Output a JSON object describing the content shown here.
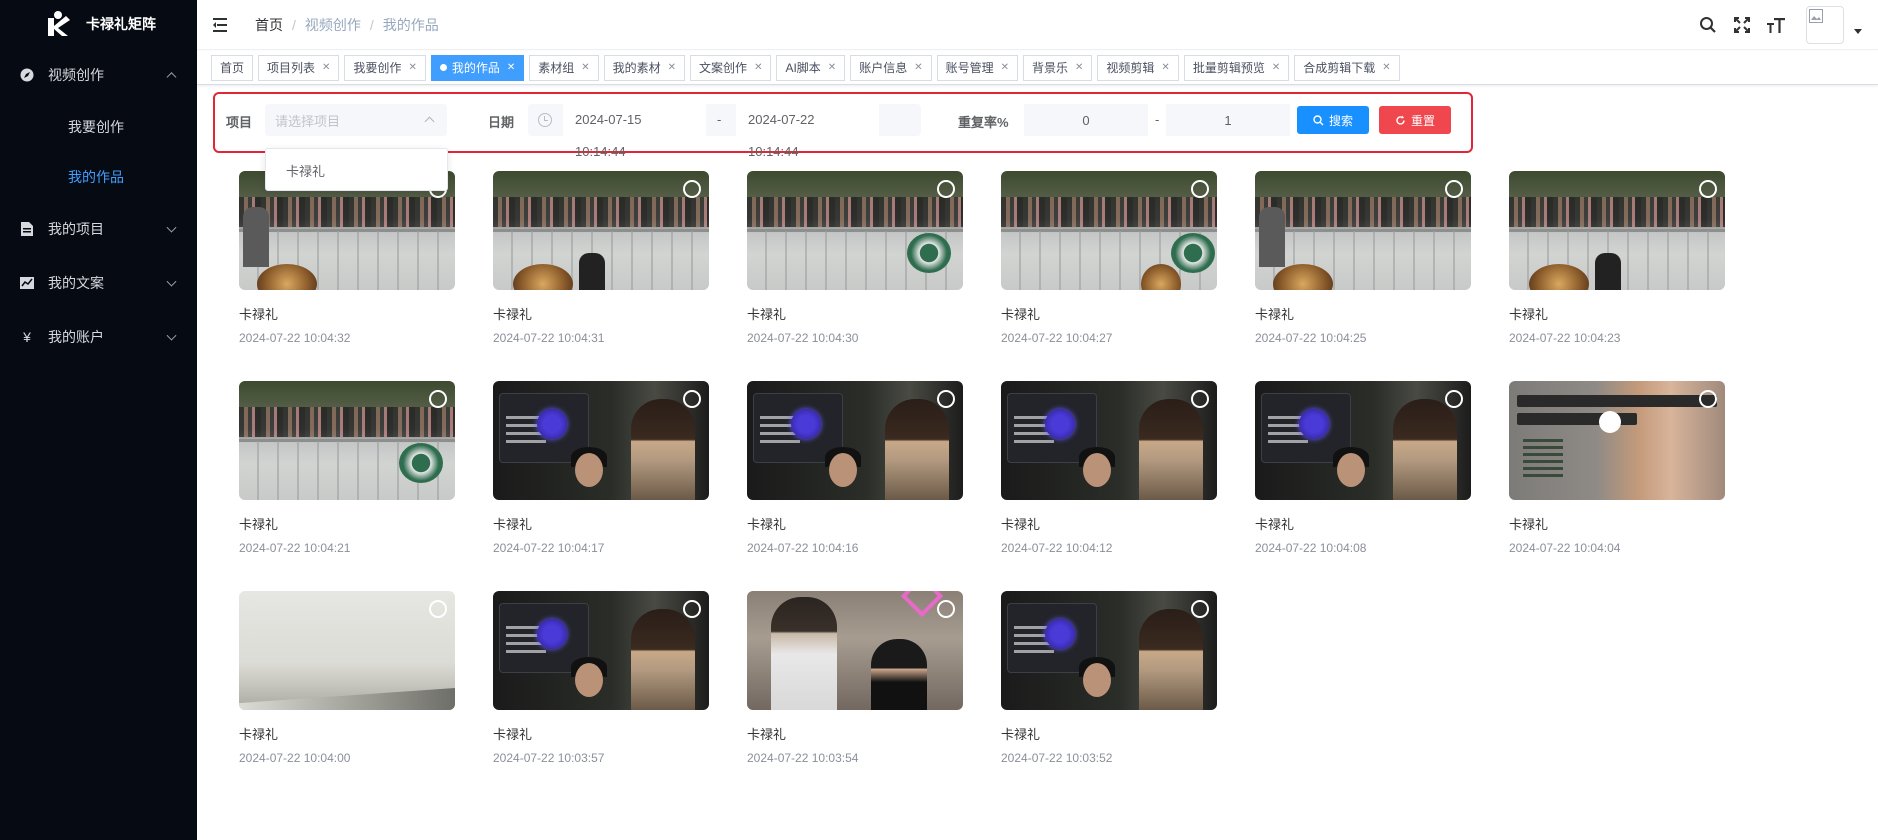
{
  "app": {
    "name": "卡禄礼矩阵"
  },
  "sidebar": {
    "items": [
      {
        "label": "视频创作",
        "icon": "compass-icon",
        "expanded": true,
        "children": [
          {
            "label": "我要创作",
            "active": false
          },
          {
            "label": "我的作品",
            "active": true
          }
        ]
      },
      {
        "label": "我的项目",
        "icon": "document-icon",
        "expanded": false
      },
      {
        "label": "我的文案",
        "icon": "chart-icon",
        "expanded": false
      },
      {
        "label": "我的账户",
        "icon": "yen-icon",
        "expanded": false
      }
    ]
  },
  "header": {
    "breadcrumb": [
      "首页",
      "视频创作",
      "我的作品"
    ],
    "icons": [
      "search-icon",
      "fullscreen-icon",
      "font-size-icon"
    ]
  },
  "tags": [
    {
      "label": "首页",
      "closable": false,
      "active": false
    },
    {
      "label": "项目列表",
      "closable": true,
      "active": false
    },
    {
      "label": "我要创作",
      "closable": true,
      "active": false
    },
    {
      "label": "我的作品",
      "closable": true,
      "active": true
    },
    {
      "label": "素材组",
      "closable": true,
      "active": false
    },
    {
      "label": "我的素材",
      "closable": true,
      "active": false
    },
    {
      "label": "文案创作",
      "closable": true,
      "active": false
    },
    {
      "label": "AI脚本",
      "closable": true,
      "active": false
    },
    {
      "label": "账户信息",
      "closable": true,
      "active": false
    },
    {
      "label": "账号管理",
      "closable": true,
      "active": false
    },
    {
      "label": "背景乐",
      "closable": true,
      "active": false
    },
    {
      "label": "视频剪辑",
      "closable": true,
      "active": false
    },
    {
      "label": "批量剪辑预览",
      "closable": true,
      "active": false
    },
    {
      "label": "合成剪辑下载",
      "closable": true,
      "active": false
    }
  ],
  "filter": {
    "project_label": "项目",
    "project_placeholder": "请选择项目",
    "date_label": "日期",
    "date_start": "2024-07-15 10:14:44",
    "date_sep": "-",
    "date_end": "2024-07-22 10:14:44",
    "repeat_label": "重复率%",
    "repeat_min": "0",
    "repeat_sep": "-",
    "repeat_max": "1",
    "search_label": "搜索",
    "reset_label": "重置",
    "dropdown_option": "卡禄礼",
    "highlight_color": "#e32636",
    "search_color": "#1890ff",
    "reset_color": "#f0464d"
  },
  "works": [
    {
      "title": "卡禄礼",
      "time": "2024-07-22 10:04:32",
      "thumb": "crowd"
    },
    {
      "title": "卡禄礼",
      "time": "2024-07-22 10:04:31",
      "thumb": "crowd"
    },
    {
      "title": "卡禄礼",
      "time": "2024-07-22 10:04:30",
      "thumb": "crowd"
    },
    {
      "title": "卡禄礼",
      "time": "2024-07-22 10:04:27",
      "thumb": "crowd"
    },
    {
      "title": "卡禄礼",
      "time": "2024-07-22 10:04:25",
      "thumb": "crowd"
    },
    {
      "title": "卡禄礼",
      "time": "2024-07-22 10:04:23",
      "thumb": "crowd"
    },
    {
      "title": "卡禄礼",
      "time": "2024-07-22 10:04:21",
      "thumb": "crowd"
    },
    {
      "title": "卡禄礼",
      "time": "2024-07-22 10:04:17",
      "thumb": "screen"
    },
    {
      "title": "卡禄礼",
      "time": "2024-07-22 10:04:16",
      "thumb": "screen"
    },
    {
      "title": "卡禄礼",
      "time": "2024-07-22 10:04:12",
      "thumb": "screen"
    },
    {
      "title": "卡禄礼",
      "time": "2024-07-22 10:04:08",
      "thumb": "screen"
    },
    {
      "title": "卡禄礼",
      "time": "2024-07-22 10:04:04",
      "thumb": "tech"
    },
    {
      "title": "卡禄礼",
      "time": "2024-07-22 10:04:00",
      "thumb": "blank"
    },
    {
      "title": "卡禄礼",
      "time": "2024-07-22 10:03:57",
      "thumb": "screen"
    },
    {
      "title": "卡禄礼",
      "time": "2024-07-22 10:03:54",
      "thumb": "mall"
    },
    {
      "title": "卡禄礼",
      "time": "2024-07-22 10:03:52",
      "thumb": "screen"
    }
  ]
}
